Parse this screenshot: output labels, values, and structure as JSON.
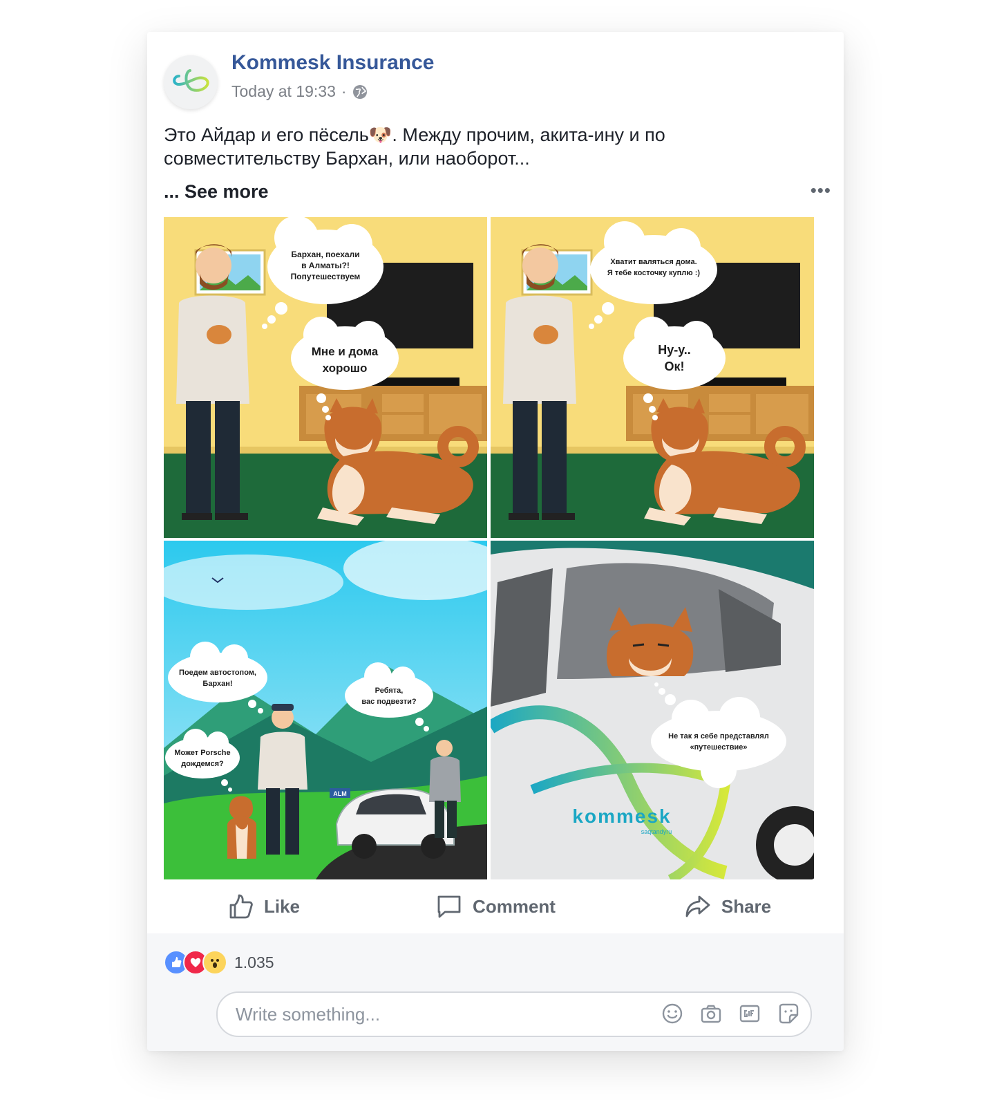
{
  "post": {
    "page_name": "Kommesk Insurance",
    "timestamp": "Today at 19:33",
    "separator": "·",
    "text": "Это Айдар и его пёсель🐶. Между прочим, акита-ину и по совместительству Бархан, или наоборот...",
    "see_more": "... See more",
    "more_icon": "•••"
  },
  "comic": {
    "panel1": {
      "bubble_man": [
        "Бархан, поехали",
        "в Алматы?!",
        "Попутешествуем"
      ],
      "bubble_dog": [
        "Мне и дома",
        "хорошо"
      ]
    },
    "panel2": {
      "bubble_man": [
        "Хватит валяться дома.",
        "Я тебе косточку куплю :)"
      ],
      "bubble_dog": [
        "Ну-у..",
        "Ок!"
      ]
    },
    "panel3": {
      "bubble_man": [
        "Поедем автостопом,",
        "Бархан!"
      ],
      "bubble_dog": [
        "Может Porsche",
        "дождемся?"
      ],
      "bubble_driver": [
        "Ребята,",
        "вас подвезти?"
      ],
      "plate": "ALM"
    },
    "panel4": {
      "bubble_dog": [
        "Не так я себе представлял",
        "«путешествие»"
      ],
      "brand": "kommesk",
      "brand_sub": "saqtandyru"
    }
  },
  "actions": {
    "like": "Like",
    "comment": "Comment",
    "share": "Share"
  },
  "reactions": {
    "count": "1.035",
    "types": [
      "like-icon",
      "love-icon",
      "wow-icon"
    ],
    "colors": {
      "like": "#5890ff",
      "love": "#f0284a",
      "wow": "#fcd45c"
    }
  },
  "composer": {
    "placeholder": "Write something...",
    "tools": [
      "emoji-icon",
      "camera-icon",
      "gif-icon",
      "sticker-icon"
    ]
  },
  "colors": {
    "link": "#365899",
    "panel_wall": "#f8dc7a",
    "panel_floor": "#1e6a3a",
    "sky": "#5fd3ee",
    "brand_teal": "#1ba7c4"
  }
}
